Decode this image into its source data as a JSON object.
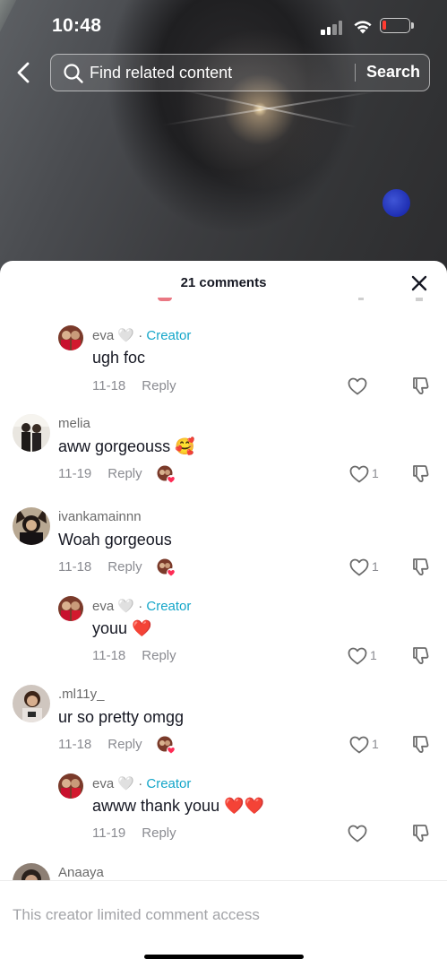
{
  "status_bar": {
    "time": "10:48"
  },
  "search": {
    "placeholder": "Find related content",
    "button_label": "Search"
  },
  "comments_panel": {
    "title": "21 comments",
    "comments": [
      {
        "username": "eva 🤍",
        "creator_label": "Creator",
        "text": "ugh foc",
        "date": "11-18",
        "reply_label": "Reply",
        "likes": ""
      },
      {
        "username": "melia",
        "text": "aww gorgeouss 🥰",
        "date": "11-19",
        "reply_label": "Reply",
        "likes": "1"
      },
      {
        "username": "ivankamainnn",
        "text": "Woah gorgeous",
        "date": "11-18",
        "reply_label": "Reply",
        "likes": "1"
      },
      {
        "username": "eva 🤍",
        "creator_label": "Creator",
        "text": "youu ❤️",
        "date": "11-18",
        "reply_label": "Reply",
        "likes": "1"
      },
      {
        "username": ".ml11y_",
        "text": "ur so pretty omgg",
        "date": "11-18",
        "reply_label": "Reply",
        "likes": "1"
      },
      {
        "username": "eva 🤍",
        "creator_label": "Creator",
        "text": "awww thank youu ❤️❤️",
        "date": "11-19",
        "reply_label": "Reply",
        "likes": ""
      },
      {
        "username": "Anaaya"
      }
    ]
  },
  "footer": {
    "message": "This creator limited comment access"
  },
  "colors": {
    "creator": "#14a6c9",
    "accent_red": "#fe2c55",
    "battery_low": "#ff3b30"
  }
}
